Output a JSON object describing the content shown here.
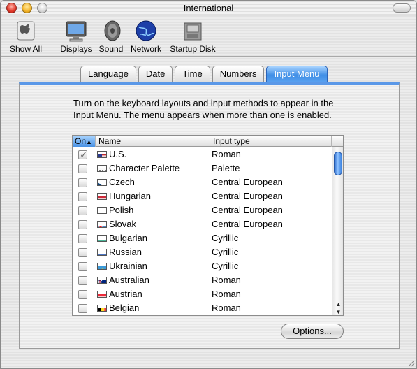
{
  "window": {
    "title": "International"
  },
  "toolbar": {
    "items": [
      {
        "label": "Show All",
        "icon": "show-all-icon"
      },
      {
        "label": "Displays",
        "icon": "display-icon"
      },
      {
        "label": "Sound",
        "icon": "speaker-icon"
      },
      {
        "label": "Network",
        "icon": "globe-icon"
      },
      {
        "label": "Startup Disk",
        "icon": "disk-icon"
      }
    ]
  },
  "tabs": [
    {
      "label": "Language",
      "active": false
    },
    {
      "label": "Date",
      "active": false
    },
    {
      "label": "Time",
      "active": false
    },
    {
      "label": "Numbers",
      "active": false
    },
    {
      "label": "Input Menu",
      "active": true
    }
  ],
  "intro": "Turn on the keyboard layouts and input methods to appear in the Input Menu. The menu appears when more than one is enabled.",
  "table": {
    "headers": {
      "on": "On",
      "name": "Name",
      "type": "Input type"
    },
    "rows": [
      {
        "on": true,
        "name": "U.S.",
        "type": "Roman",
        "flag": "us"
      },
      {
        "on": false,
        "name": "Character Palette",
        "type": "Palette",
        "flag": "palette"
      },
      {
        "on": false,
        "name": "Czech",
        "type": "Central European",
        "flag": "cz"
      },
      {
        "on": false,
        "name": "Hungarian",
        "type": "Central European",
        "flag": "hu"
      },
      {
        "on": false,
        "name": "Polish",
        "type": "Central European",
        "flag": "pl"
      },
      {
        "on": false,
        "name": "Slovak",
        "type": "Central European",
        "flag": "sk"
      },
      {
        "on": false,
        "name": "Bulgarian",
        "type": "Cyrillic",
        "flag": "bg"
      },
      {
        "on": false,
        "name": "Russian",
        "type": "Cyrillic",
        "flag": "ru"
      },
      {
        "on": false,
        "name": "Ukrainian",
        "type": "Cyrillic",
        "flag": "ua"
      },
      {
        "on": false,
        "name": "Australian",
        "type": "Roman",
        "flag": "au"
      },
      {
        "on": false,
        "name": "Austrian",
        "type": "Roman",
        "flag": "at"
      },
      {
        "on": false,
        "name": "Belgian",
        "type": "Roman",
        "flag": "be"
      }
    ]
  },
  "options_button": "Options...",
  "colors": {
    "accent": "#3f8ee6"
  }
}
